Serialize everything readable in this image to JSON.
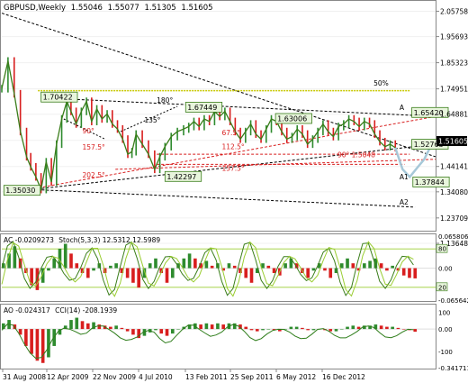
{
  "chart_data": [
    {
      "type": "line",
      "panel": "price",
      "title": "GBPUSD,Weekly",
      "ohlc_label": {
        "open": "1.55046",
        "high": "1.55077",
        "low": "1.51305",
        "close": "1.51605"
      },
      "last_price": "1.51605",
      "ylim": [
        1.19,
        2.095
      ],
      "y_ticks": [
        "2.05758",
        "1.95693",
        "1.85323",
        "1.74951",
        "1.64881",
        "1.54511",
        "1.44141",
        "1.34080",
        "1.23709",
        "1.13648"
      ],
      "x": [
        0,
        6,
        12,
        18,
        24,
        28,
        33,
        38,
        43,
        48,
        53,
        58,
        63,
        67,
        72,
        77,
        82,
        87,
        92,
        97,
        102,
        107,
        112,
        117,
        122,
        126,
        130,
        136,
        142,
        148,
        153,
        158,
        164,
        170,
        176,
        181,
        186,
        191,
        196,
        201,
        206,
        211,
        216,
        221,
        226,
        231,
        236,
        241,
        246,
        251,
        256,
        261,
        266,
        271,
        276,
        281,
        286,
        291,
        296,
        301,
        306,
        311,
        316,
        321,
        326,
        331,
        336,
        341,
        346,
        351,
        356,
        361,
        366,
        371,
        376,
        381
      ],
      "close": [
        1.75,
        1.86,
        1.73,
        1.58,
        1.48,
        1.44,
        1.4,
        1.35,
        1.46,
        1.38,
        1.53,
        1.63,
        1.7,
        1.66,
        1.61,
        1.66,
        1.7,
        1.62,
        1.67,
        1.63,
        1.65,
        1.61,
        1.59,
        1.55,
        1.49,
        1.5,
        1.57,
        1.53,
        1.49,
        1.43,
        1.48,
        1.52,
        1.56,
        1.58,
        1.59,
        1.6,
        1.62,
        1.6,
        1.63,
        1.62,
        1.66,
        1.64,
        1.66,
        1.62,
        1.58,
        1.55,
        1.58,
        1.61,
        1.57,
        1.55,
        1.59,
        1.63,
        1.62,
        1.58,
        1.55,
        1.56,
        1.59,
        1.57,
        1.53,
        1.55,
        1.58,
        1.61,
        1.58,
        1.56,
        1.6,
        1.61,
        1.63,
        1.62,
        1.6,
        1.62,
        1.61,
        1.57,
        1.54,
        1.52,
        1.53,
        1.516
      ],
      "forecast": [
        {
          "x": [
            381,
            388,
            395,
            402,
            409,
            415
          ],
          "y": [
            1.516,
            1.43,
            1.4,
            1.435,
            1.47,
            1.52
          ]
        }
      ],
      "price_labels": [
        "1.70422",
        "1.67449",
        "1.63006",
        "1.65420",
        "1.52763",
        "1.37844",
        "1.42297",
        "1.35030"
      ],
      "annotations": [
        "50%",
        "180°",
        "135°",
        "90°",
        "157.5°",
        "202.5°",
        "67.5°",
        "112.5°",
        "90° 1.5048",
        "157.5°",
        "A",
        "A1",
        "A2"
      ],
      "x_ticks": [
        "31 Aug 2008",
        "12 Apr 2009",
        "22 Nov 2009",
        "4 Jul 2010",
        "13 Feb 2011",
        "25 Sep 2011",
        "6 May 2012",
        "16 Dec 2012"
      ]
    },
    {
      "type": "bar",
      "panel": "AC",
      "label": "AC -0.0209273",
      "stoch_label": "Stoch(5,3,3) 12.5312 12.5989",
      "ylim": [
        -0.0656,
        0.0659
      ],
      "y_ticks": [
        "0.065806",
        "0.00",
        "-0.065642"
      ],
      "stoch_levels": [
        "80",
        "20"
      ],
      "values": [
        0.01,
        0.03,
        0.045,
        0.02,
        -0.01,
        -0.035,
        -0.045,
        -0.03,
        -0.005,
        0.02,
        0.04,
        0.05,
        0.03,
        0.01,
        -0.01,
        -0.02,
        -0.005,
        0.01,
        -0.01,
        0.005,
        0.01,
        -0.01,
        -0.02,
        -0.03,
        -0.04,
        -0.02,
        0.01,
        0.02,
        -0.01,
        -0.03,
        -0.02,
        0.01,
        0.02,
        0.03,
        0.02,
        0.01,
        0.015,
        0.005,
        0.01,
        -0.005,
        0.01,
        0.005,
        -0.01,
        -0.02,
        -0.03,
        -0.01,
        0.01,
        0.005,
        -0.01,
        -0.015,
        0.01,
        0.02,
        0.01,
        -0.01,
        -0.02,
        -0.005,
        0.01,
        -0.005,
        -0.02,
        -0.01,
        0.01,
        0.02,
        0.01,
        -0.005,
        0.01,
        0.015,
        0.02,
        0.01,
        -0.005,
        0.005,
        -0.005,
        -0.015,
        -0.02,
        -0.021
      ]
    },
    {
      "type": "bar",
      "panel": "AO",
      "label": "AO -0.024317",
      "cci_label": "CCI(14) -208.1939",
      "ylim": [
        -0.3417,
        0.2
      ],
      "y_ticks": [
        "100",
        "0.00",
        "-100",
        "-0.341711"
      ],
      "values": [
        0.05,
        0.08,
        0.04,
        -0.05,
        -0.15,
        -0.22,
        -0.28,
        -0.3,
        -0.25,
        -0.15,
        -0.05,
        0.03,
        0.08,
        0.1,
        0.07,
        0.05,
        0.06,
        0.04,
        0.03,
        0.02,
        0.03,
        0.01,
        -0.02,
        -0.05,
        -0.08,
        -0.06,
        -0.03,
        -0.01,
        -0.04,
        -0.06,
        -0.04,
        0.0,
        0.02,
        0.04,
        0.05,
        0.04,
        0.05,
        0.04,
        0.05,
        0.04,
        0.05,
        0.05,
        0.04,
        0.02,
        -0.01,
        -0.02,
        -0.01,
        0.0,
        -0.01,
        -0.02,
        0.0,
        0.02,
        0.02,
        0.01,
        -0.01,
        -0.01,
        0.0,
        -0.01,
        -0.02,
        -0.02,
        0.0,
        0.02,
        0.03,
        0.02,
        0.03,
        0.03,
        0.04,
        0.03,
        0.02,
        0.02,
        0.01,
        0.0,
        -0.01,
        -0.024
      ]
    }
  ],
  "colors": {
    "price_line": "#3a7d1a",
    "up_bar": "#2e8b2e",
    "down_bar": "#d81e1e",
    "label_fill": "#e8f5dc",
    "label_border": "#3a7d1a",
    "dash_black": "#000000",
    "dash_red": "#d81e1e",
    "yellow_line": "#c8c800",
    "forecast": "#a6c8d8"
  }
}
